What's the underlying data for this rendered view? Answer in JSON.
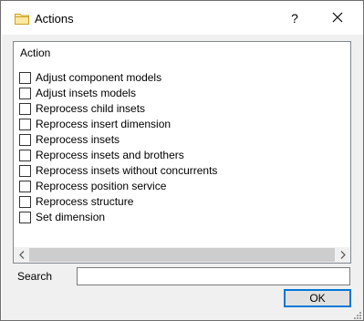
{
  "window": {
    "title": "Actions",
    "help_label": "?",
    "icons": {
      "title": "folder-icon",
      "close": "close-icon"
    }
  },
  "list": {
    "header": "Action",
    "items": [
      {
        "label": "Adjust component models",
        "checked": false
      },
      {
        "label": "Adjust insets models",
        "checked": false
      },
      {
        "label": "Reprocess child insets",
        "checked": false
      },
      {
        "label": "Reprocess insert dimension",
        "checked": false
      },
      {
        "label": "Reprocess insets",
        "checked": false
      },
      {
        "label": "Reprocess insets and brothers",
        "checked": false
      },
      {
        "label": "Reprocess insets without concurrents",
        "checked": false
      },
      {
        "label": "Reprocess position service",
        "checked": false
      },
      {
        "label": "Reprocess structure",
        "checked": false
      },
      {
        "label": "Set dimension",
        "checked": false
      }
    ]
  },
  "search": {
    "label": "Search",
    "value": ""
  },
  "buttons": {
    "ok": "OK"
  }
}
